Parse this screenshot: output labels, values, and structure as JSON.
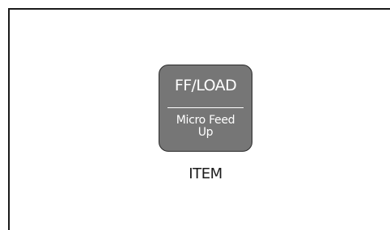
{
  "key": {
    "primary_label": "FF/LOAD",
    "secondary_label_line1": "Micro Feed",
    "secondary_label_line2": "Up",
    "caption": "ITEM"
  },
  "colors": {
    "key_face": "#767676",
    "key_text": "#ffffff",
    "frame": "#1a1a1a"
  }
}
